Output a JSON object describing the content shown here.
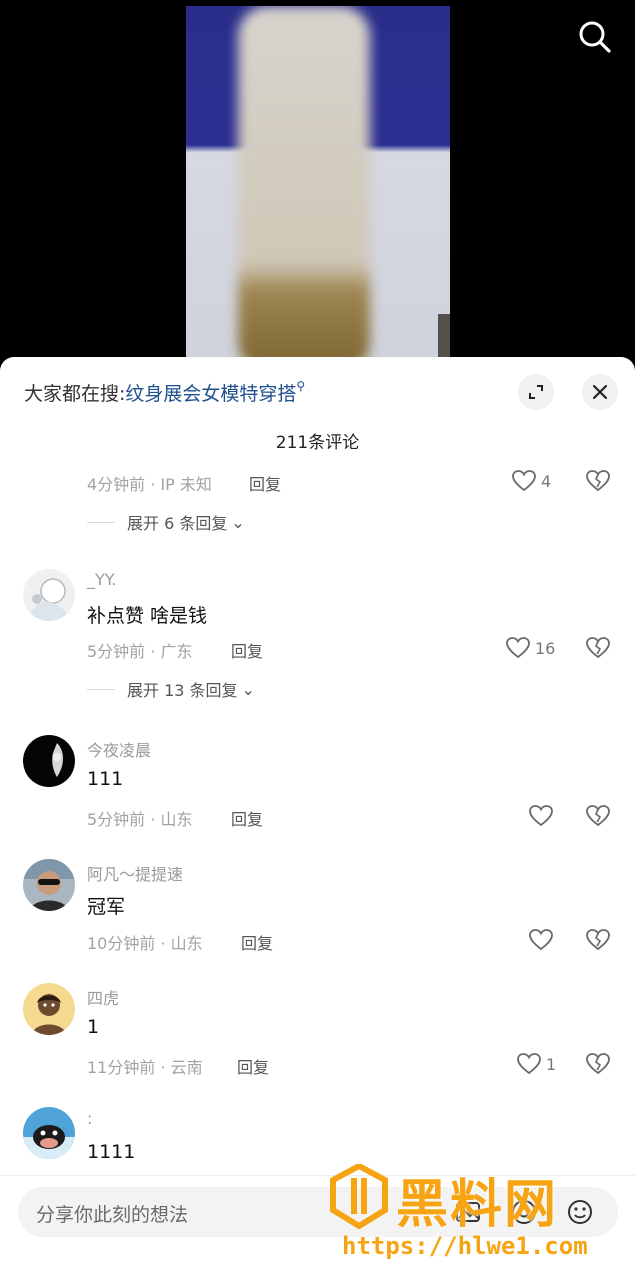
{
  "video": {
    "search_icon": "search-icon"
  },
  "header": {
    "hot_search_prefix": "大家都在搜:",
    "hot_search_keyword": "纹身展会女模特穿搭",
    "comment_count": "211条评论"
  },
  "partial_comment": {
    "time_location": "4分钟前 · IP 未知",
    "reply": "回复",
    "likes": "4",
    "expand": "展开 6 条回复"
  },
  "comments": [
    {
      "username": "_YY.",
      "text": "补点赞 啥是钱",
      "time_location": "5分钟前 · 广东",
      "reply": "回复",
      "likes": "16",
      "expand": "展开 13 条回复"
    },
    {
      "username": "今夜凌晨",
      "text": "111",
      "time_location": "5分钟前 · 山东",
      "reply": "回复",
      "likes": ""
    },
    {
      "username": "阿凡～提提速",
      "text": "冠军",
      "time_location": "10分钟前 · 山东",
      "reply": "回复",
      "likes": ""
    },
    {
      "username": "四虎",
      "text": "1",
      "time_location": "11分钟前 · 云南",
      "reply": "回复",
      "likes": "1"
    },
    {
      "username": ":",
      "text": "1111",
      "time_location": "",
      "reply": "",
      "likes": ""
    }
  ],
  "input": {
    "placeholder": "分享你此刻的想法"
  },
  "watermark": {
    "title": "黑料网",
    "url": "https://hlwe1.com"
  },
  "colors": {
    "keyword": "#1f4f8f",
    "watermark": "#f6a414"
  }
}
